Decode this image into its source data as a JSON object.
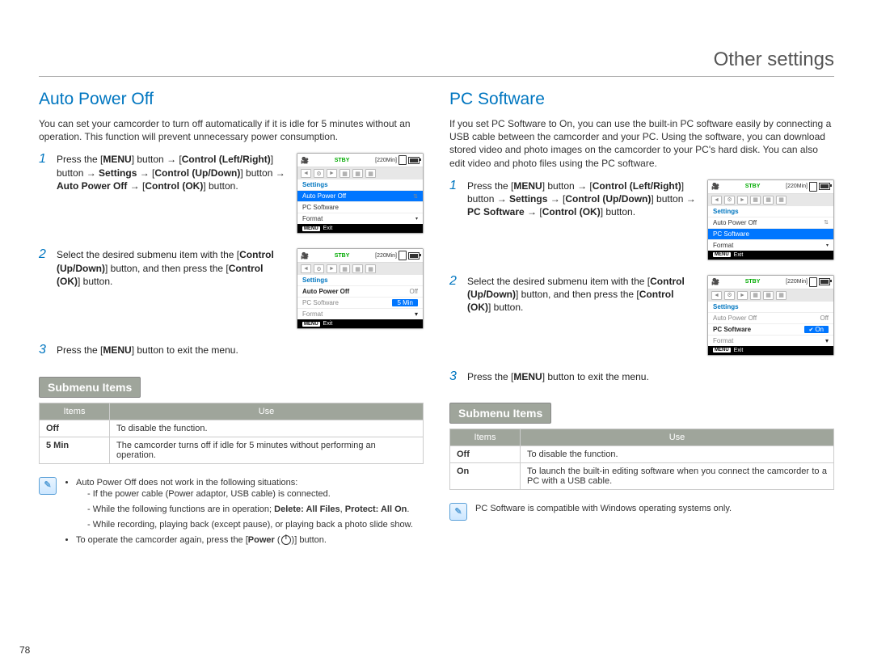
{
  "page": {
    "title": "Other settings",
    "number": "78"
  },
  "left": {
    "heading": "Auto Power Off",
    "intro": "You can set your camcorder to turn off automatically if it is idle for 5 minutes without an operation. This function will prevent unnecessary power consumption.",
    "step1_a": "Press the [",
    "step1_menu": "MENU",
    "step1_b": "] button → ",
    "step1_control_lr": "Control (Left/Right)",
    "step1_c": "] button → ",
    "step1_settings": "Settings",
    "step1_d": " → [",
    "step1_control_ud": "Control (Up/Down)",
    "step1_e": "] button → ",
    "step1_apo": "Auto Power Off",
    "step1_f": " → ",
    "step1_ok": "Control (OK)",
    "step1_g": "] button.",
    "step2_a": "Select the desired submenu item with the [",
    "step2_cud": "Control (Up/Down)",
    "step2_b": "] button, and then press the [",
    "step2_ok": "Control (OK)",
    "step2_c": "] button.",
    "step3_a": "Press the [",
    "step3_menu": "MENU",
    "step3_b": "] button to exit the menu.",
    "submenu_header": "Submenu Items",
    "table_h1": "Items",
    "table_h2": "Use",
    "row1_item": "Off",
    "row1_use": "To disable the function.",
    "row2_item": "5 Min",
    "row2_use": "The camcorder turns off if idle for 5 minutes without performing an operation.",
    "note1": "Auto Power Off does not work in the following situations:",
    "note1a": "If the power cable (Power adaptor, USB cable) is connected.",
    "note1b_a": "While the following functions are in operation; ",
    "note1b_b": "Delete: All Files",
    "note1b_c": ", ",
    "note1b_d": "Protect: All On",
    "note1b_e": ".",
    "note1c": "While recording, playing back (except pause), or playing back a photo slide show.",
    "note2_a": "To operate the camcorder again, press the [",
    "note2_b": "Power",
    "note2_c": " (",
    "note2_d": ")] button."
  },
  "right": {
    "heading": "PC Software",
    "intro": "If you set PC Software to On, you can use the built-in PC software easily by connecting a USB cable between the camcorder and your PC. Using the software, you can download stored video and photo images on the camcorder to your PC's hard disk. You can also edit video and photo files using the PC software.",
    "step1_a": "Press the [",
    "step1_menu": "MENU",
    "step1_b": "] button → ",
    "step1_control_lr": "Control (Left/Right)",
    "step1_c": "] button → ",
    "step1_settings": "Settings",
    "step1_d": " → [",
    "step1_control_ud": "Control (Up/Down)",
    "step1_e": "] button → ",
    "step1_pcs": "PC Software",
    "step1_f": " → ",
    "step1_ok": "Control (OK)",
    "step1_g": "] button.",
    "step2_a": "Select the desired submenu item with the [",
    "step2_cud": "Control (Up/Down)",
    "step2_b": "] button, and then press the [",
    "step2_ok": "Control (OK)",
    "step2_c": "] button.",
    "step3_a": "Press the [",
    "step3_menu": "MENU",
    "step3_b": "] button to exit the menu.",
    "submenu_header": "Submenu Items",
    "table_h1": "Items",
    "table_h2": "Use",
    "row1_item": "Off",
    "row1_use": "To disable the function.",
    "row2_item": "On",
    "row2_use": "To launch the built-in editing software when you connect the camcorder to a PC with a USB cable.",
    "note": "PC Software is compatible with Windows operating systems only."
  },
  "lcd": {
    "stby": "STBY",
    "time": "[220Min]",
    "settings": "Settings",
    "auto_power_off": "Auto Power Off",
    "pc_software": "PC Software",
    "format": "Format",
    "exit": "Exit",
    "menu": "MENU",
    "off": "Off",
    "five_min": "5 Min",
    "on": "On"
  }
}
